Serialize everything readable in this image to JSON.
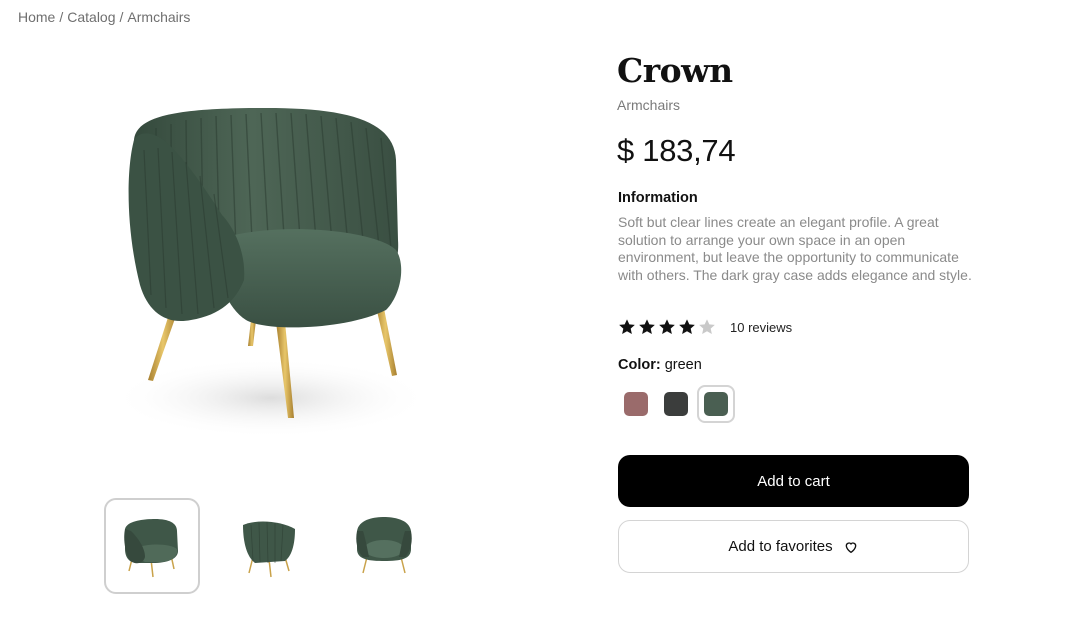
{
  "breadcrumb": {
    "home": "Home",
    "catalog": "Catalog",
    "current": "Armchairs",
    "separator": "/"
  },
  "product": {
    "title": "Crown",
    "category": "Armchairs",
    "price": "$ 183,74",
    "info_heading": "Information",
    "info_text": "Soft but clear lines create an elegant profile. A great solution to arrange your own space in an open environment, but leave the opportunity to communicate with others. The dark gray case adds elegance and style.",
    "rating": 4,
    "rating_max": 5,
    "reviews_label": "10 reviews",
    "color_label": "Color:",
    "color_value": "green",
    "swatches": [
      {
        "name": "rose",
        "hex": "#9a6b6b"
      },
      {
        "name": "dark gray",
        "hex": "#3b3d3c"
      },
      {
        "name": "green",
        "hex": "#4a5f52"
      }
    ],
    "selected_swatch": 2
  },
  "thumbnails": {
    "count": 3,
    "selected": 0
  },
  "actions": {
    "add_to_cart": "Add to cart",
    "add_to_favorites": "Add to favorites"
  },
  "colors": {
    "accent": "#000000",
    "chair": "#3f5748",
    "legs": "#c9a24a"
  },
  "icons": {
    "star": "star-icon",
    "favorite": "heart-icon"
  }
}
